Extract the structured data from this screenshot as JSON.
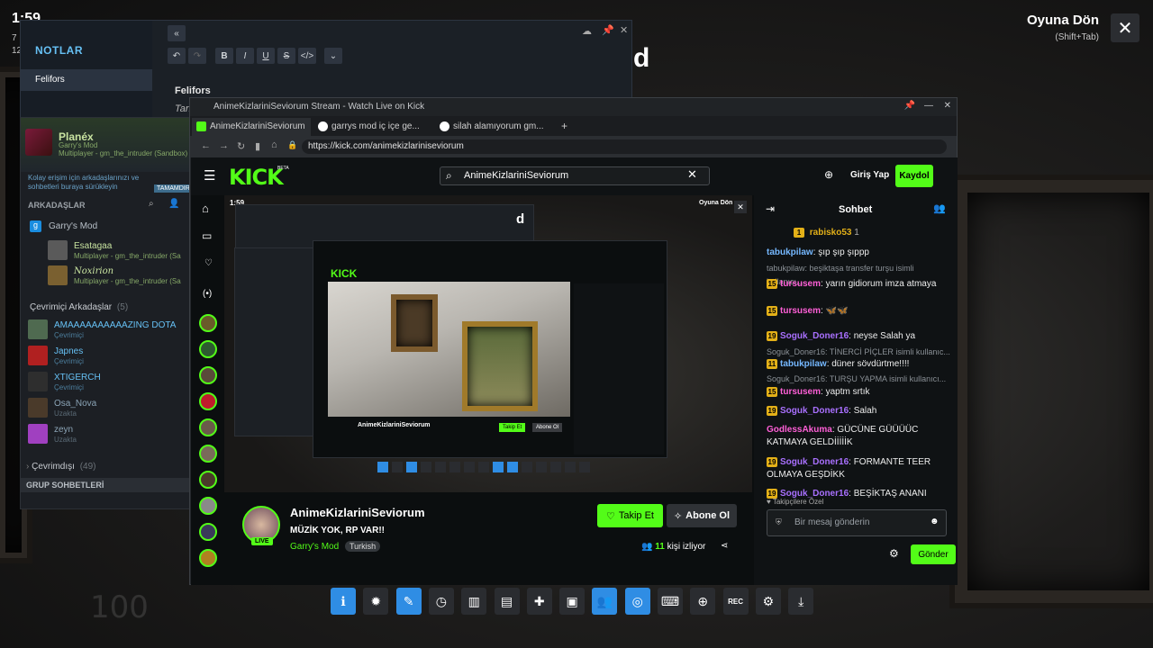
{
  "overlay": {
    "clock": "1:59",
    "clock_sub_1": "7",
    "clock_sub_2": "12",
    "resume_title": "Oyuna Dön",
    "resume_shortcut": "(Shift+Tab)",
    "big_letter": "d",
    "bg_number": "100"
  },
  "notes": {
    "title": "NOTLAR",
    "items": [
      "Felifors"
    ],
    "heading": "Felifors",
    "sub_text": "Tan"
  },
  "friends": {
    "user_name": "Planéx",
    "user_game": "Garry's Mod",
    "user_status": "Multiplayer - gm_the_intruder (Sandbox)",
    "hint": "Kolay erişim için arkadaşlarınızı ve sohbetleri buraya sürükleyin",
    "hint_button": "TAMAMDIR",
    "section_friends": "ARKADAŞLAR",
    "group_game": "Garry's Mod",
    "ingame": [
      {
        "name": "Esatagaa",
        "status": "Multiplayer - gm_the_intruder (Sa"
      },
      {
        "name": "Noxirion",
        "status": "Multiplayer - gm_the_intruder (Sa"
      }
    ],
    "online_header": "Çevrimiçi Arkadaşlar",
    "online_count": "(5)",
    "online": [
      {
        "name": "AMAAAAAAAAAAZING DOTA",
        "status": "Çevrimiçi",
        "color": "#66c0f4"
      },
      {
        "name": "Japnes",
        "status": "Çevrimiçi",
        "color": "#66c0f4"
      },
      {
        "name": "XTIGERCH",
        "status": "Çevrimiçi",
        "color": "#66c0f4"
      },
      {
        "name": "Osa_Nova",
        "status": "Uzakta",
        "color": "#8aa3b5"
      },
      {
        "name": "zeyn",
        "status": "Uzakta",
        "color": "#8aa3b5"
      }
    ],
    "offline_header": "Çevrimdışı",
    "offline_count": "(49)",
    "group_header": "GRUP SOHBETLERİ"
  },
  "browser": {
    "window_title": "AnimeKizlariniSeviorum Stream - Watch Live on Kick",
    "tabs": [
      {
        "label": "AnimeKizlariniSeviorum",
        "active": true
      },
      {
        "label": "garrys mod iç içe ge...",
        "active": false
      },
      {
        "label": "silah alamıyorum gm...",
        "active": false
      }
    ],
    "new_tab": "+",
    "url": "https://kick.com/animekizlariniseviorum"
  },
  "kick": {
    "logo": "KICK",
    "logo_tag": "BETA",
    "search_value": "AnimeKizlariniSeviorum",
    "login_label": "Giriş Yap",
    "signup_label": "Kaydol",
    "streamer": "AnimeKizlariniSeviorum",
    "stream_title": "MÜZİK YOK, RP VAR!!",
    "category": "Garry's Mod",
    "language": "Turkish",
    "live_label": "LIVE",
    "follow_label": "Takip Et",
    "subscribe_label": "Abone Ol",
    "viewers_count": "11",
    "viewers_label": "kişi izliyor",
    "chat_title": "Sohbet",
    "pinned_user": "rabisko53",
    "pinned_count": "1",
    "followers_only": "Takipçilere Özel",
    "chat_placeholder": "Bir mesaj gönderin",
    "send_label": "Gönder",
    "messages": [
      {
        "kind": "msg",
        "badge": "",
        "user": "tabukpilaw",
        "cls": "u-blue",
        "text": "şıp şıp şıppp"
      },
      {
        "kind": "sys",
        "text": "tabukpilaw: beşiktaşa transfer turşu isimli kullanıcı..."
      },
      {
        "kind": "msg",
        "badge": "15",
        "user": "tursusem",
        "cls": "u-pink",
        "text": "yarın gidiorum imza atmaya"
      },
      {
        "kind": "msg",
        "badge": "15",
        "user": "tursusem",
        "cls": "u-pink",
        "text": "🦋🦋"
      },
      {
        "kind": "msg",
        "badge": "19",
        "user": "Soguk_Doner16",
        "cls": "u-purple",
        "text": "neyse Salah ya"
      },
      {
        "kind": "sys",
        "text": "Soguk_Doner16: TİNERCİ PİÇLER isimli kullanıc..."
      },
      {
        "kind": "msg",
        "badge": "11",
        "user": "tabukpilaw",
        "cls": "u-blue",
        "text": "düner sövdürtme!!!!"
      },
      {
        "kind": "sys",
        "text": "Soguk_Doner16: TURŞU YAPMA isimli kullanıcı..."
      },
      {
        "kind": "msg",
        "badge": "15",
        "user": "tursusem",
        "cls": "u-pink",
        "text": "yaptm srtık"
      },
      {
        "kind": "msg",
        "badge": "19",
        "user": "Soguk_Doner16",
        "cls": "u-purple",
        "text": "Salah"
      },
      {
        "kind": "msg",
        "badge": "",
        "user": "GodlessAkuma",
        "cls": "u-pink",
        "text": "GÜCÜNE GÜÜÜÜC KATMAYA GELDİİİİİK"
      },
      {
        "kind": "msg",
        "badge": "19",
        "user": "Soguk_Doner16",
        "cls": "u-purple",
        "text": "FORMANTE TEER OLMAYA GEŞDİKK"
      },
      {
        "kind": "msg",
        "badge": "19",
        "user": "Soguk_Doner16",
        "cls": "u-purple",
        "text": "BEŞİKTAŞ ANANI"
      }
    ]
  },
  "colors": {
    "kick_green": "#53fc18",
    "steam_blue": "#66c0f4",
    "dock_blue": "#2f8de4"
  },
  "dock_icons": [
    {
      "name": "info-icon",
      "glyph": "ℹ",
      "blue": true
    },
    {
      "name": "achievements-icon",
      "glyph": "✹",
      "blue": false
    },
    {
      "name": "notes-icon",
      "glyph": "✎",
      "blue": true
    },
    {
      "name": "clock-icon",
      "glyph": "◷",
      "blue": false
    },
    {
      "name": "guide-icon",
      "glyph": "▥",
      "blue": false
    },
    {
      "name": "chat-icon",
      "glyph": "▤",
      "blue": false
    },
    {
      "name": "wrench-icon",
      "glyph": "✚",
      "blue": false
    },
    {
      "name": "screenshots-icon",
      "glyph": "▣",
      "blue": false
    },
    {
      "name": "friends-icon",
      "glyph": "👥",
      "blue": true
    },
    {
      "name": "browser-icon",
      "glyph": "◎",
      "blue": true
    },
    {
      "name": "controller-icon",
      "glyph": "⌨",
      "blue": false
    },
    {
      "name": "globe-icon",
      "glyph": "⊕",
      "blue": false
    },
    {
      "name": "recording-icon",
      "glyph": "REC",
      "blue": false
    },
    {
      "name": "settings-icon",
      "glyph": "⚙",
      "blue": false
    },
    {
      "name": "minimize-icon",
      "glyph": "⤓",
      "blue": false
    }
  ]
}
